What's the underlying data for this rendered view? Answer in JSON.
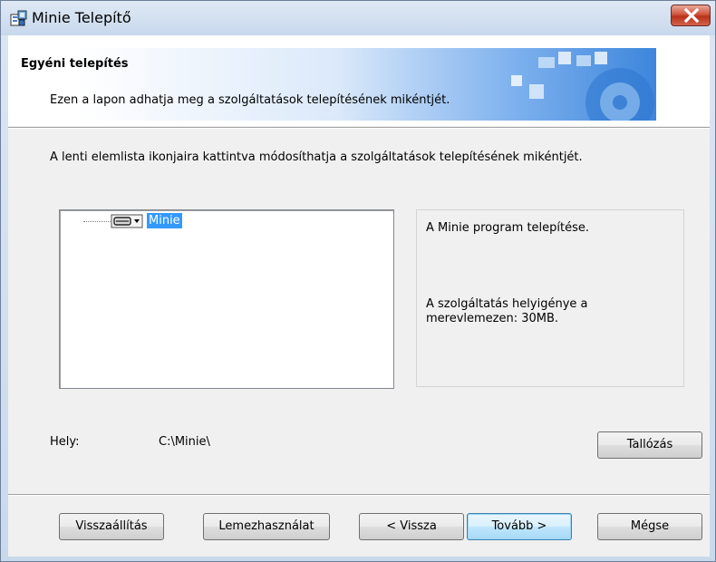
{
  "window": {
    "title": "Minie Telepítő",
    "app_icon": "installer-icon",
    "close_icon": "close-icon"
  },
  "banner": {
    "title": "Egyéni telepítés",
    "description": "Ezen a lapon adhatja meg a szolgáltatások telepítésének mikéntjét."
  },
  "instruction": "A lenti elemlista ikonjaira kattintva módosíthatja a szolgáltatások telepítésének mikéntjét.",
  "tree": {
    "items": [
      {
        "label": "Minie",
        "icon": "feature-drive-dropdown-icon",
        "selected": true
      }
    ]
  },
  "info": {
    "description": "A Minie program telepítése.",
    "size_text": "A szolgáltatás helyigénye a merevlemezen: 30MB."
  },
  "location": {
    "label": "Hely:",
    "value": "C:\\Minie\\"
  },
  "buttons": {
    "browse": "Tallózás",
    "reset": "Visszaállítás",
    "disk_usage": "Lemezhasználat",
    "back": "< Vissza",
    "next": "Tovább >",
    "cancel": "Mégse"
  },
  "colors": {
    "selection": "#3399ff",
    "close_red": "#c9462c",
    "titlebar": "#c8d8ec"
  }
}
